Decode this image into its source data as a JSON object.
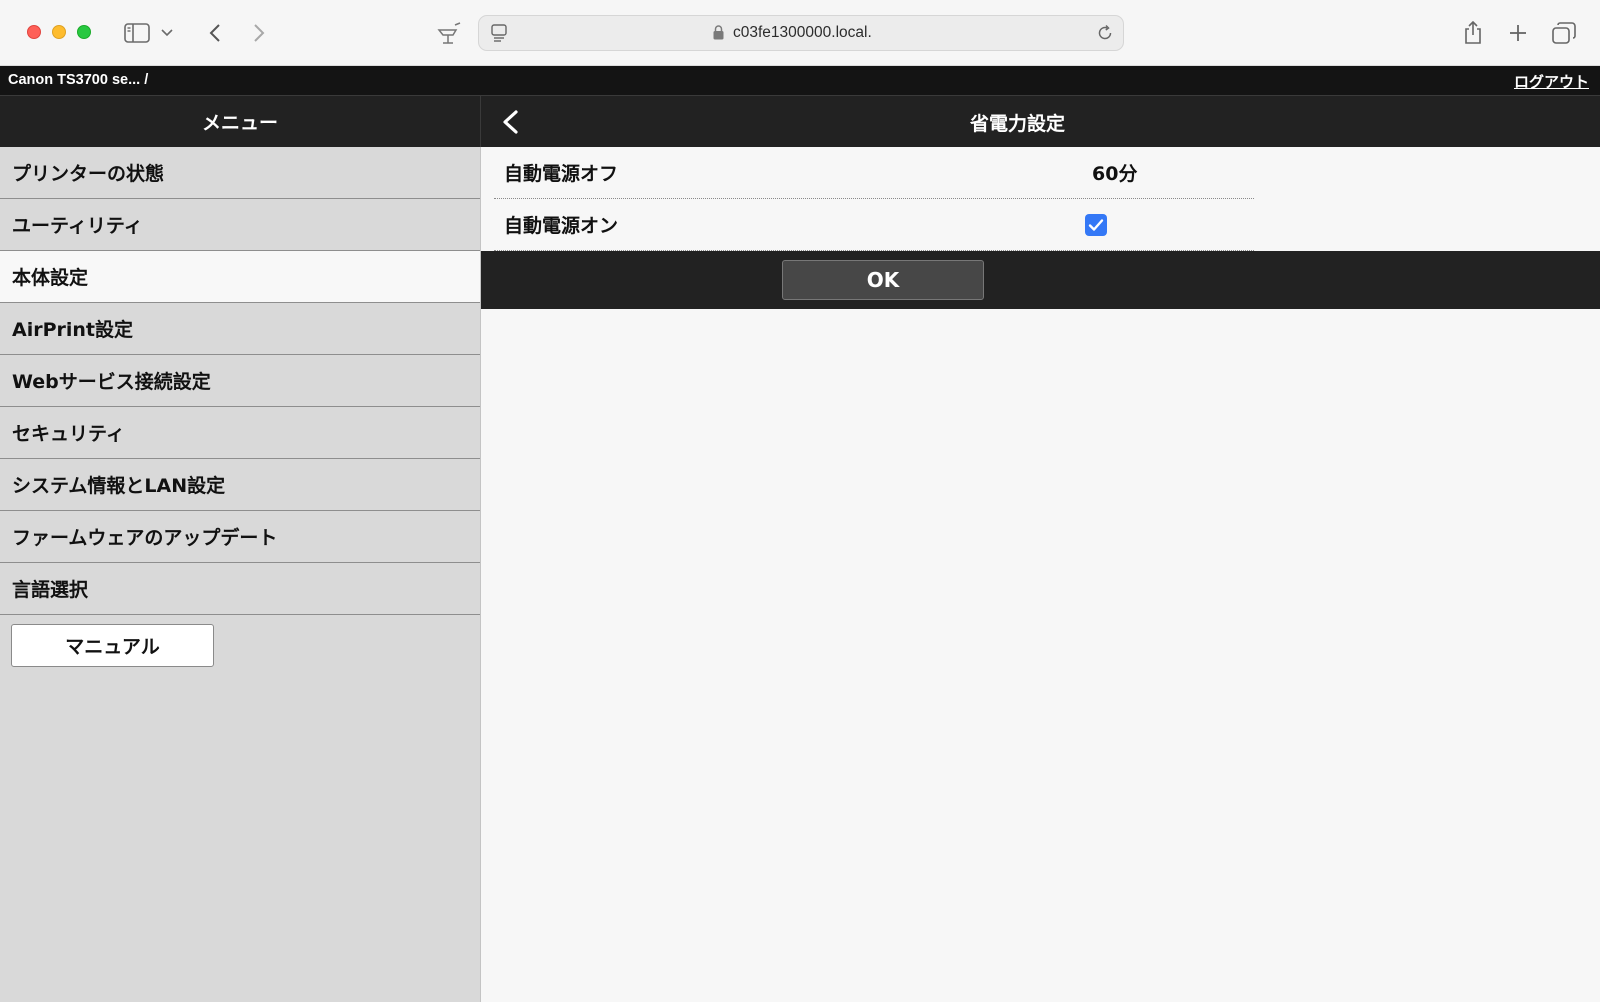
{
  "browser": {
    "url": "c03fe1300000.local.",
    "icons": [
      "sidebar-icon",
      "chevron-down-icon",
      "back-arrow-icon",
      "forward-arrow-icon",
      "privacy-icon",
      "page-icon",
      "lock-icon",
      "reload-icon",
      "share-icon",
      "plus-icon",
      "tabs-icon"
    ]
  },
  "page_header": {
    "device": "Canon TS3700 se... /",
    "logout": "ログアウト"
  },
  "menu": {
    "title": "メニュー",
    "items": [
      {
        "label": "プリンターの状態"
      },
      {
        "label": "ユーティリティ"
      },
      {
        "label": "本体設定",
        "active": true
      },
      {
        "label": "AirPrint設定"
      },
      {
        "label": "Webサービス接続設定"
      },
      {
        "label": "セキュリティ"
      },
      {
        "label": "システム情報とLAN設定"
      },
      {
        "label": "ファームウェアのアップデート"
      },
      {
        "label": "言語選択"
      }
    ],
    "manual_button": "マニュアル"
  },
  "content": {
    "title": "省電力設定",
    "settings": [
      {
        "label": "自動電源オフ",
        "value": "60分"
      },
      {
        "label": "自動電源オン",
        "checked": true
      }
    ],
    "ok_button": "OK"
  },
  "colors": {
    "dark_bar": "#222222",
    "sidebar_bg": "#d9d9d9",
    "active_item_bg": "#f8f8f8",
    "checkbox": "#3478f6"
  }
}
